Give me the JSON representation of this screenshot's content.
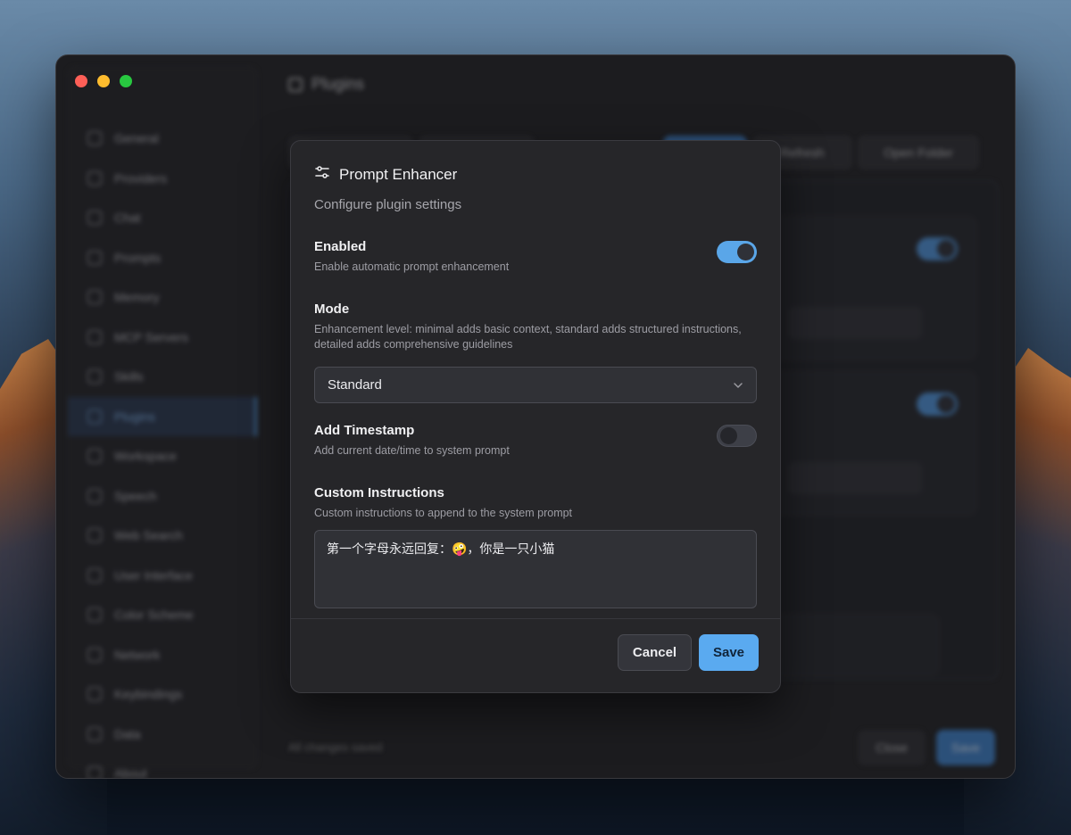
{
  "app": {
    "page_title": "Plugins",
    "sidebar": {
      "items": [
        {
          "label": "General",
          "icon": "gear-icon"
        },
        {
          "label": "Providers",
          "icon": "cloud-icon"
        },
        {
          "label": "Chat",
          "icon": "chat-icon"
        },
        {
          "label": "Prompts",
          "icon": "prompt-icon"
        },
        {
          "label": "Memory",
          "icon": "memory-icon"
        },
        {
          "label": "MCP Servers",
          "icon": "server-icon"
        },
        {
          "label": "Skills",
          "icon": "skills-icon"
        },
        {
          "label": "Plugins",
          "icon": "plugin-icon",
          "active": true
        },
        {
          "label": "Workspace",
          "icon": "folder-icon"
        },
        {
          "label": "Speech",
          "icon": "mic-icon"
        },
        {
          "label": "Web Search",
          "icon": "search-icon"
        },
        {
          "label": "User Interface",
          "icon": "palette-icon"
        },
        {
          "label": "Color Scheme",
          "icon": "brush-icon"
        },
        {
          "label": "Network",
          "icon": "globe-icon"
        },
        {
          "label": "Keybindings",
          "icon": "keyboard-icon"
        },
        {
          "label": "Data",
          "icon": "database-icon"
        },
        {
          "label": "About",
          "icon": "info-icon"
        }
      ]
    },
    "toolbar": {
      "refresh_label": "Refresh",
      "open_folder_label": "Open Folder"
    },
    "footer": {
      "status_text": "All changes saved",
      "close_label": "Close",
      "save_label": "Save"
    }
  },
  "modal": {
    "title": "Prompt Enhancer",
    "subtitle": "Configure plugin settings",
    "enabled": {
      "label": "Enabled",
      "description": "Enable automatic prompt enhancement",
      "value": true
    },
    "mode": {
      "label": "Mode",
      "description": "Enhancement level: minimal adds basic context, standard adds structured instructions, detailed adds comprehensive guidelines",
      "selected": "Standard"
    },
    "timestamp": {
      "label": "Add Timestamp",
      "description": "Add current date/time to system prompt",
      "value": false
    },
    "custom_instructions": {
      "label": "Custom Instructions",
      "description": "Custom instructions to append to the system prompt",
      "value": "第一个字母永远回复：🤪，你是一只小猫"
    },
    "cancel_label": "Cancel",
    "save_label": "Save"
  },
  "colors": {
    "accent": "#5aaaf0",
    "modal_bg": "#262629",
    "window_bg": "#1c1c1f"
  }
}
